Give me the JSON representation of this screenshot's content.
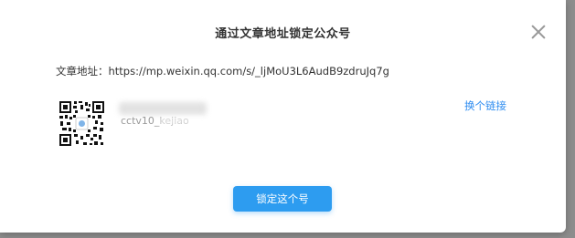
{
  "dialog": {
    "title": "通过文章地址锁定公众号",
    "close_icon": "close-icon"
  },
  "article_url": {
    "label": "文章地址：",
    "value": "https://mp.weixin.qq.com/s/_ljMoU3L6AudB9zdruJq7g"
  },
  "account": {
    "qr_icon": "qr-code-icon",
    "id_text": "cctv10_kejiao",
    "change_link_label": "换个链接"
  },
  "actions": {
    "lock_button_label": "锁定这个号"
  },
  "colors": {
    "accent": "#2d9cf0",
    "link": "#2d8cf0",
    "overlay": "#8d8d8d"
  }
}
